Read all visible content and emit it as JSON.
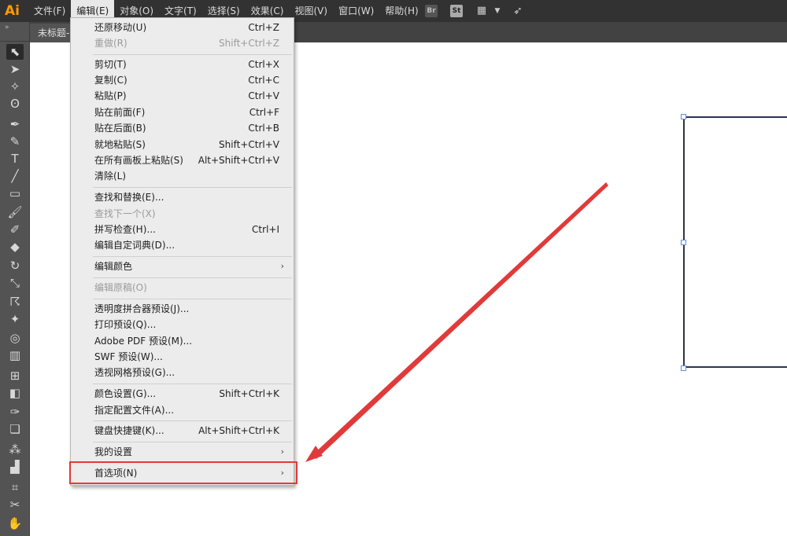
{
  "app": {
    "logo": "Ai"
  },
  "menubar": {
    "items": [
      "文件(F)",
      "编辑(E)",
      "对象(O)",
      "文字(T)",
      "选择(S)",
      "效果(C)",
      "视图(V)",
      "窗口(W)",
      "帮助(H)"
    ],
    "active_index": 1,
    "right_icons": {
      "br": "Br",
      "st": "St"
    }
  },
  "toolbar": {
    "expand": "»"
  },
  "document": {
    "tab_title": "未标题-1"
  },
  "dropdown": {
    "items": [
      {
        "label": "还原移动(U)",
        "shortcut": "Ctrl+Z",
        "disabled": false,
        "submenu": false
      },
      {
        "label": "重做(R)",
        "shortcut": "Shift+Ctrl+Z",
        "disabled": true,
        "submenu": false
      },
      {
        "label": "剪切(T)",
        "shortcut": "Ctrl+X",
        "disabled": false,
        "submenu": false
      },
      {
        "label": "复制(C)",
        "shortcut": "Ctrl+C",
        "disabled": false,
        "submenu": false
      },
      {
        "label": "粘贴(P)",
        "shortcut": "Ctrl+V",
        "disabled": false,
        "submenu": false
      },
      {
        "label": "贴在前面(F)",
        "shortcut": "Ctrl+F",
        "disabled": false,
        "submenu": false
      },
      {
        "label": "贴在后面(B)",
        "shortcut": "Ctrl+B",
        "disabled": false,
        "submenu": false
      },
      {
        "label": "就地粘贴(S)",
        "shortcut": "Shift+Ctrl+V",
        "disabled": false,
        "submenu": false
      },
      {
        "label": "在所有画板上粘贴(S)",
        "shortcut": "Alt+Shift+Ctrl+V",
        "disabled": false,
        "submenu": false
      },
      {
        "label": "清除(L)",
        "shortcut": "",
        "disabled": false,
        "submenu": false
      },
      {
        "label": "查找和替换(E)...",
        "shortcut": "",
        "disabled": false,
        "submenu": false
      },
      {
        "label": "查找下一个(X)",
        "shortcut": "",
        "disabled": true,
        "submenu": false
      },
      {
        "label": "拼写检查(H)...",
        "shortcut": "Ctrl+I",
        "disabled": false,
        "submenu": false
      },
      {
        "label": "编辑自定词典(D)...",
        "shortcut": "",
        "disabled": false,
        "submenu": false
      },
      {
        "label": "编辑颜色",
        "shortcut": "",
        "disabled": false,
        "submenu": true
      },
      {
        "label": "编辑原稿(O)",
        "shortcut": "",
        "disabled": true,
        "submenu": false
      },
      {
        "label": "透明度拼合器预设(J)...",
        "shortcut": "",
        "disabled": false,
        "submenu": false
      },
      {
        "label": "打印预设(Q)...",
        "shortcut": "",
        "disabled": false,
        "submenu": false
      },
      {
        "label": "Adobe PDF 预设(M)...",
        "shortcut": "",
        "disabled": false,
        "submenu": false
      },
      {
        "label": "SWF 预设(W)...",
        "shortcut": "",
        "disabled": false,
        "submenu": false
      },
      {
        "label": "透视网格预设(G)...",
        "shortcut": "",
        "disabled": false,
        "submenu": false
      },
      {
        "label": "颜色设置(G)...",
        "shortcut": "Shift+Ctrl+K",
        "disabled": false,
        "submenu": false
      },
      {
        "label": "指定配置文件(A)...",
        "shortcut": "",
        "disabled": false,
        "submenu": false
      },
      {
        "label": "键盘快捷键(K)...",
        "shortcut": "Alt+Shift+Ctrl+K",
        "disabled": false,
        "submenu": false
      },
      {
        "label": "我的设置",
        "shortcut": "",
        "disabled": false,
        "submenu": true
      },
      {
        "label": "首选项(N)",
        "shortcut": "",
        "disabled": false,
        "submenu": true
      }
    ],
    "submenu_glyph": "›"
  },
  "colors": {
    "annotation_red": "#e13a3a",
    "menubar_bg": "#323232",
    "menu_bg": "#ececec"
  }
}
